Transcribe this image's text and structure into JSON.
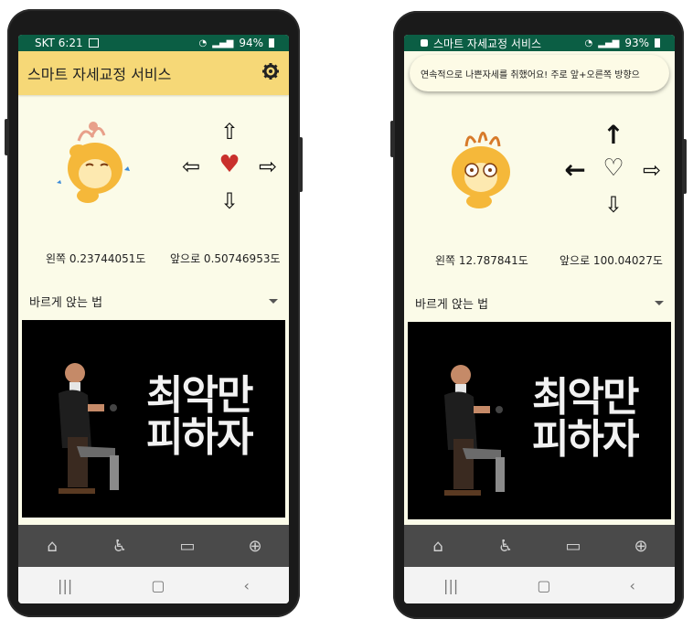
{
  "phone1": {
    "status": {
      "carrier": "SKT 6:21",
      "battery": "94%"
    },
    "app_title": "스마트 자세교정 서비스",
    "left_angle": "왼쪽 0.23744051도",
    "front_angle": "앞으로 0.50746953도",
    "dropdown_label": "바르게 앉는 법",
    "video_text_line1": "최악만",
    "video_text_line2": "피하자",
    "heart_color": "#c9302c"
  },
  "phone2": {
    "status": {
      "app_title_in_status": "스마트 자세교정 서비스",
      "battery": "93%"
    },
    "toast": "연속적으로 나쁜자세를 취했어요! 주로 앞+오른쪽 방향으",
    "left_angle": "왼쪽 12.787841도",
    "front_angle": "앞으로 100.04027도",
    "dropdown_label": "바르게 앉는 법",
    "video_text_line1": "최악만",
    "video_text_line2": "피하자"
  },
  "bottom_nav_icons": [
    "home-icon",
    "wheelchair-icon",
    "tv-icon",
    "cart-icon"
  ],
  "colors": {
    "status_bar": "#0b5e44",
    "app_bar": "#f6d877",
    "background": "#fbfbe8",
    "bottom_nav": "#4a4a4a"
  }
}
